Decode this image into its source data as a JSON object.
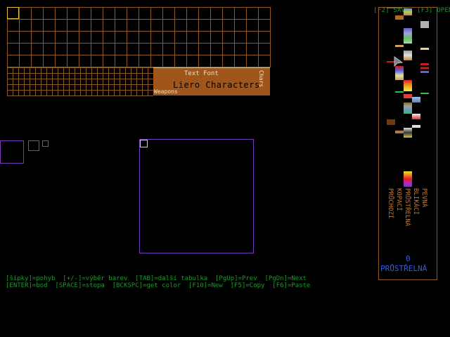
{
  "top_keys": {
    "save": "[F2] SAVE",
    "open": "[F3] OPEN",
    "color": "#1a9a2a"
  },
  "editor": {
    "text_font_label": "Text Font",
    "title": "Liero Characters",
    "weapons_label": "Weapons",
    "chars_label": "Chars",
    "panel_color": "#a0561a"
  },
  "help": {
    "line1": "[šípky]=pohyb  [+/-]=výběr barev  [TAB]=další tabulka  [PgUp]=Prev  [PgDn]=Next",
    "line2": "[ENTER]=bod  [SPACE]=stopa  [BCKSPC]=get color  [F10]=New  [F5]=Copy  [F6]=Paste",
    "color": "#1a9a2a"
  },
  "palette": {
    "labels": [
      "PEVNÁ",
      "BLIKÁCÍ",
      "PRŮSTŘELNÁ",
      "KOPACÍ",
      "PRŮCHOZÍ"
    ],
    "selected_index": "0",
    "selected_material": "PRŮSTŘELNÁ",
    "label_color": "#c8782a",
    "selected_color": "#3a5adc"
  },
  "icons": {
    "cursor": "arrow-cursor-icon"
  }
}
